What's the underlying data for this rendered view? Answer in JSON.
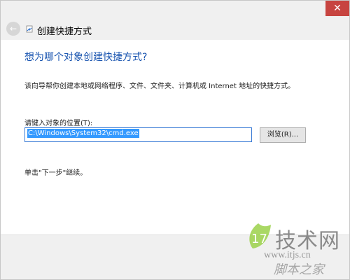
{
  "window": {
    "close_glyph": "✕"
  },
  "header": {
    "back_glyph": "←",
    "title": "创建快捷方式"
  },
  "content": {
    "heading": "想为哪个对象创建快捷方式?",
    "description": "该向导帮你创建本地或网络程序、文件、文件夹、计算机或 Internet 地址的快捷方式。",
    "location_label": "请键入对象的位置(T):",
    "location_value": "C:\\Windows\\System32\\cmd.exe",
    "browse_label": "浏览(R)...",
    "instruction": "单击\"下一步\"继续。"
  },
  "watermark": {
    "brand": "技术网",
    "url": "www.itjs.cn",
    "sub": "脚本之家"
  },
  "colors": {
    "heading": "#1a55b0",
    "close_button": "#c74440",
    "selection": "#3399ff",
    "input_border": "#3a7bd5"
  }
}
